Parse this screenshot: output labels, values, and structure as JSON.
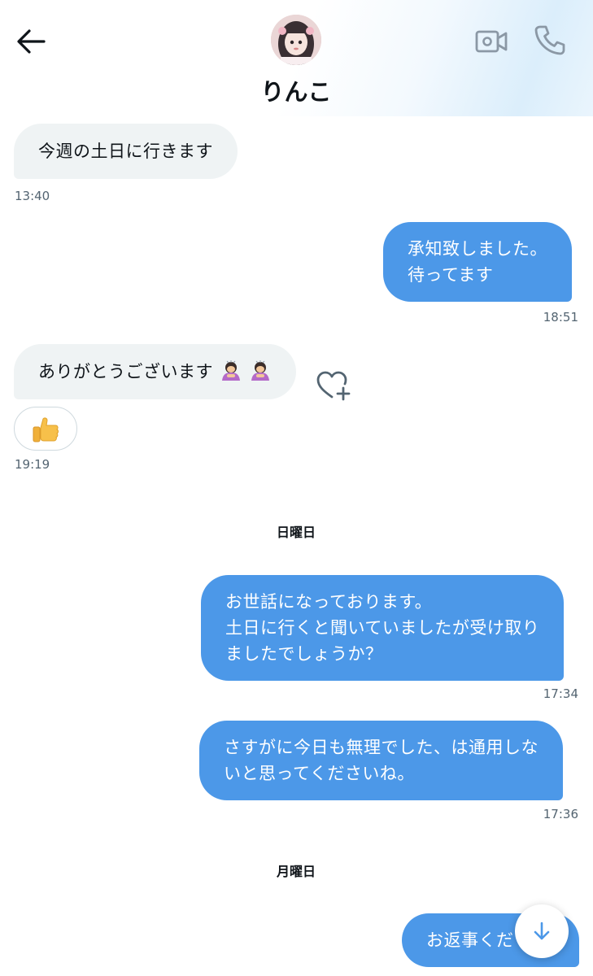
{
  "header": {
    "contact_name": "りんこ",
    "icons": {
      "back": "arrow-left-icon",
      "video": "video-camera-icon",
      "call": "phone-icon"
    }
  },
  "messages": [
    {
      "direction": "in",
      "lines": [
        "今週の土日に行きます"
      ],
      "time": "13:40"
    },
    {
      "direction": "out",
      "lines": [
        "承知致しました。",
        "待ってます"
      ],
      "time": "18:51"
    },
    {
      "direction": "in",
      "lines": [
        "ありがとうございます"
      ],
      "emoji": [
        "woman-bowing-emoji",
        "woman-bowing-emoji"
      ],
      "reaction": "thumbs-up-emoji",
      "time": "19:19"
    },
    {
      "direction": "out",
      "lines": [
        "お世話になっております。",
        "土日に行くと聞いていましたが受け取り",
        "ましたでしょうか？"
      ],
      "time": "17:34"
    },
    {
      "direction": "out",
      "lines": [
        "さすがに今日も無理でした、は通用しな",
        "いと思ってくださいね。"
      ],
      "time": "17:36"
    },
    {
      "direction": "out",
      "lines": [
        "お返事くだ"
      ],
      "time": ""
    }
  ],
  "day_separators": [
    "日曜日",
    "月曜日"
  ],
  "colors": {
    "outgoing_bubble": "#4c98e8",
    "incoming_bubble": "#eff3f4",
    "timestamp": "#536471"
  },
  "scroll_button_icon": "arrow-down-icon"
}
